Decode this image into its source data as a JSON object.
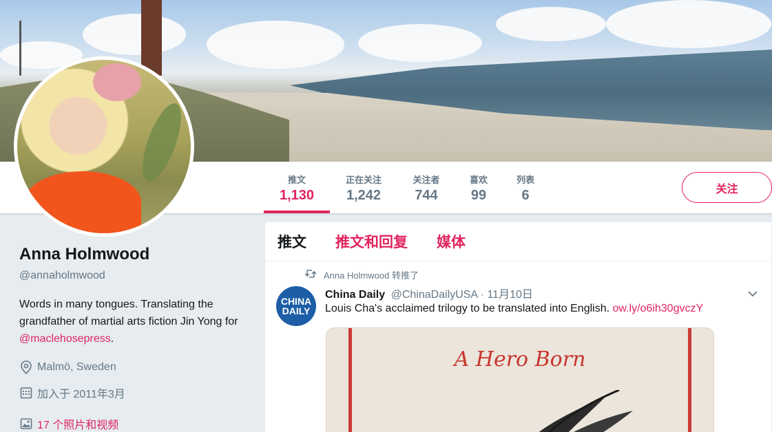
{
  "profile": {
    "name": "Anna Holmwood",
    "handle": "@annaholmwood",
    "bio_text": "Words in many tongues. Translating the grandfather of martial arts fiction Jin Yong for ",
    "bio_link": "@maclehosepress",
    "bio_end": ".",
    "location": "Malmö, Sweden",
    "joined": "加入于 2011年3月",
    "media_link": "17 个照片和视频"
  },
  "nav": {
    "stats": [
      {
        "label": "推文",
        "value": "1,130"
      },
      {
        "label": "正在关注",
        "value": "1,242"
      },
      {
        "label": "关注者",
        "value": "744"
      },
      {
        "label": "喜欢",
        "value": "99"
      },
      {
        "label": "列表",
        "value": "6"
      }
    ],
    "follow_label": "关注"
  },
  "timeline": {
    "tabs": [
      "推文",
      "推文和回复",
      "媒体"
    ],
    "retweet_label": "Anna Holmwood 转推了",
    "tweet": {
      "avatar_text_1": "CHINA",
      "avatar_text_2": "DAILY",
      "name": "China Daily",
      "handle": "@ChinaDailyUSA",
      "separator": "·",
      "date": "11月10日",
      "text": "Louis Cha's acclaimed trilogy to be translated into English. ",
      "link": "ow.ly/o6ih30gvczY",
      "media_title": "A Hero Born"
    }
  },
  "colors": {
    "accent": "#e0245e",
    "secondary_text": "#657786",
    "background": "#e6ecf0"
  },
  "icons": [
    "location-icon",
    "calendar-icon",
    "photo-icon",
    "retweet-icon",
    "chevron-down-icon"
  ]
}
